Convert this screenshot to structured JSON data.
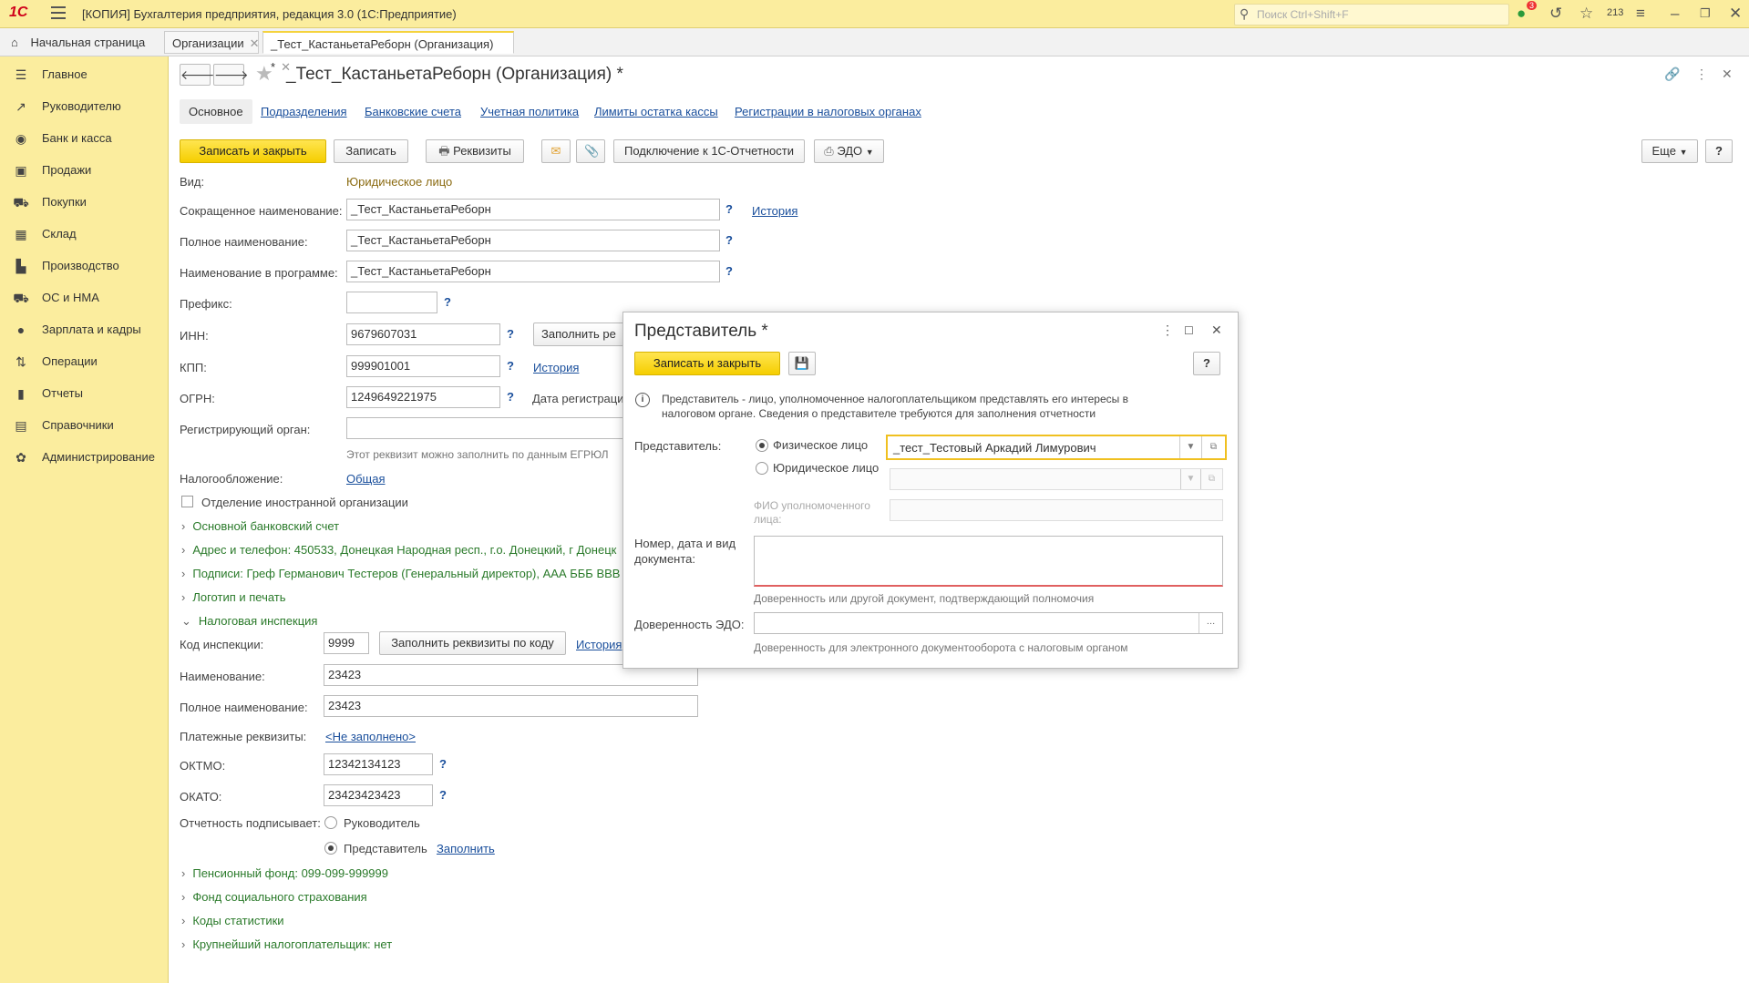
{
  "titlebar": {
    "logo": "1С",
    "title": "[КОПИЯ] Бухгалтерия предприятия, редакция 3.0  (1С:Предприятие)",
    "search_placeholder": "Поиск Ctrl+Shift+F",
    "notif_count": "3",
    "counter": "213"
  },
  "tabs": [
    {
      "label": "Начальная страница"
    },
    {
      "label": "Организации"
    },
    {
      "label": "_Тест_КастаньетаРеборн (Организация) *"
    }
  ],
  "sidebar": {
    "items": [
      {
        "label": "Главное",
        "icon": "menu-icon"
      },
      {
        "label": "Руководителю",
        "icon": "trend-icon"
      },
      {
        "label": "Банк и касса",
        "icon": "bank-icon"
      },
      {
        "label": "Продажи",
        "icon": "bag-icon"
      },
      {
        "label": "Покупки",
        "icon": "cart-icon"
      },
      {
        "label": "Склад",
        "icon": "warehouse-icon"
      },
      {
        "label": "Производство",
        "icon": "factory-icon"
      },
      {
        "label": "ОС и НМА",
        "icon": "truck-icon"
      },
      {
        "label": "Зарплата и кадры",
        "icon": "person-icon"
      },
      {
        "label": "Операции",
        "icon": "operations-icon"
      },
      {
        "label": "Отчеты",
        "icon": "chart-icon"
      },
      {
        "label": "Справочники",
        "icon": "book-icon"
      },
      {
        "label": "Администрирование",
        "icon": "gear-icon"
      }
    ]
  },
  "form": {
    "title": "_Тест_КастаньетаРеборн (Организация) *",
    "tabs": [
      {
        "label": "Основное"
      },
      {
        "label": "Подразделения"
      },
      {
        "label": "Банковские счета"
      },
      {
        "label": "Учетная политика"
      },
      {
        "label": "Лимиты остатка кассы"
      },
      {
        "label": "Регистрации в налоговых органах"
      }
    ],
    "toolbar": {
      "save_close": "Записать и закрыть",
      "save": "Записать",
      "requisites": "Реквизиты",
      "connect": "Подключение к 1С-Отчетности",
      "edo": "ЭДО",
      "more": "Еще",
      "help": "?"
    },
    "fields": {
      "kind_label": "Вид:",
      "kind_value": "Юридическое лицо",
      "short_name_label": "Сокращенное наименование:",
      "short_name_value": "_Тест_КастаньетаРеборн",
      "history": "История",
      "full_name_label": "Полное наименование:",
      "full_name_value": "_Тест_КастаньетаРеборн",
      "prog_name_label": "Наименование в программе:",
      "prog_name_value": "_Тест_КастаньетаРеборн",
      "prefix_label": "Префикс:",
      "prefix_value": "",
      "inn_label": "ИНН:",
      "inn_value": "9679607031",
      "fill_btn": "Заполнить ре",
      "kpp_label": "КПП:",
      "kpp_value": "999901001",
      "ogrn_label": "ОГРН:",
      "ogrn_value": "1249649221975",
      "reg_date_label": "Дата регистраци",
      "reg_organ_label": "Регистрирующий орган:",
      "reg_organ_hint": "Этот реквизит можно заполнить по данным ЕГРЮЛ",
      "tax_label": "Налогообложение:",
      "tax_value": "Общая",
      "foreign_label": "Отделение иностранной организации"
    },
    "groups": {
      "bank": "Основной банковский счет",
      "address": "Адрес и телефон: 450533, Донецкая Народная респ., г.о. Донецкий, г Донецк",
      "signatures": "Подписи: Греф Германович Тестеров (Генеральный директор), ААА БББ ВВВ",
      "logo": "Логотип и печать",
      "tax_inspection": "Налоговая инспекция",
      "pension": "Пенсионный фонд: 099-099-999999",
      "social": "Фонд социального страхования",
      "stats": "Коды статистики",
      "largest": "Крупнейший налогоплательщик: нет"
    },
    "inspection": {
      "code_label": "Код инспекции:",
      "code_value": "9999",
      "fill_by_code": "Заполнить реквизиты по коду",
      "history": "История",
      "name_label": "Наименование:",
      "name_value": "23423",
      "full_name_label": "Полное наименование:",
      "full_name_value": "23423",
      "payment_label": "Платежные реквизиты:",
      "payment_value": "<Не заполнено>",
      "oktmo_label": "ОКТМО:",
      "oktmo_value": "12342134123",
      "okato_label": "ОКАТО:",
      "okato_value": "23423423423",
      "signer_label": "Отчетность подписывает:",
      "signer_head": "Руководитель",
      "signer_rep": "Представитель",
      "fill_link": "Заполнить"
    }
  },
  "modal": {
    "title": "Представитель *",
    "save_close": "Записать и закрыть",
    "help": "?",
    "info": "Представитель - лицо, уполномоченное налогоплательщиком представлять его интересы в налоговом органе. Сведения о представителе требуются для заполнения отчетности",
    "rep_label": "Представитель:",
    "opt_person": "Физическое лицо",
    "opt_legal": "Юридическое лицо",
    "person_value": "_тест_Тестовый Аркадий Лимурович",
    "fio_label": "ФИО уполномоченного лица:",
    "doc_label": "Номер, дата и вид документа:",
    "doc_hint": "Доверенность или другой документ, подтверждающий полномочия",
    "edo_label": "Доверенность ЭДО:",
    "edo_hint": "Доверенность для электронного документооборота с налоговым органом"
  }
}
